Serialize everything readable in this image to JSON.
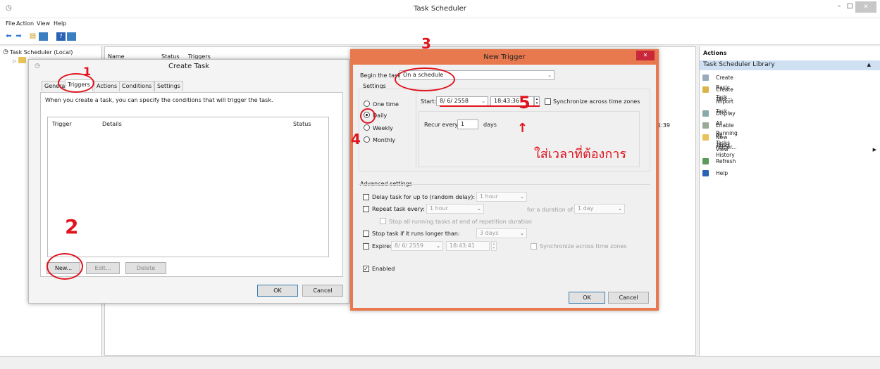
{
  "window": {
    "title": "Task Scheduler"
  },
  "menu": [
    "File",
    "Action",
    "View",
    "Help"
  ],
  "tree": {
    "root": "Task Scheduler (Local)"
  },
  "list": {
    "columns": [
      "Name",
      "Status",
      "Triggers"
    ],
    "partial_time": "1:39"
  },
  "actions": {
    "header": "Actions",
    "section": "Task Scheduler Library",
    "items": [
      "Create Basic Task...",
      "Create Task...",
      "Import Task...",
      "Display All Running Tasks",
      "Enable All Tasks History",
      "New Folder...",
      "View",
      "Refresh",
      "Help"
    ]
  },
  "create_task": {
    "title": "Create Task",
    "tabs": [
      "General",
      "Triggers",
      "Actions",
      "Conditions",
      "Settings"
    ],
    "description": "When you create a task, you can specify the conditions that will trigger the task.",
    "columns": [
      "Trigger",
      "Details",
      "Status"
    ],
    "buttons": {
      "new": "New...",
      "edit": "Edit...",
      "delete": "Delete",
      "ok": "OK",
      "cancel": "Cancel"
    }
  },
  "new_trigger": {
    "title": "New Trigger",
    "begin_label": "Begin the task:",
    "begin_value": "On a schedule",
    "settings_label": "Settings",
    "options": [
      "One time",
      "Daily",
      "Weekly",
      "Monthly"
    ],
    "selected_option": "Daily",
    "start_label": "Start:",
    "start_date": "8/ 6/ 2558",
    "start_time": "18:43:36",
    "sync_label": "Synchronize across time zones",
    "recur_label": "Recur every:",
    "recur_value": "1",
    "recur_unit": "days",
    "advanced_label": "Advanced settings",
    "delay_label": "Delay task for up to (random delay):",
    "delay_value": "1 hour",
    "repeat_label": "Repeat task every:",
    "repeat_value": "1 hour",
    "duration_label": "for a duration of:",
    "duration_value": "1 day",
    "stop_running_label": "Stop all running tasks at end of repetition duration",
    "stop_longer_label": "Stop task if it runs longer than:",
    "stop_longer_value": "3 days",
    "expire_label": "Expire:",
    "expire_date": "8/ 6/ 2559",
    "expire_time": "18:43:41",
    "expire_sync_label": "Synchronize across time zones",
    "enabled_label": "Enabled",
    "ok": "OK",
    "cancel": "Cancel"
  },
  "annotations": {
    "n1": "1",
    "n2": "2",
    "n3": "3",
    "n4": "4",
    "n5": "5",
    "thai_note": "ใส่เวลาที่ต้องการ",
    "color": "#e0141e"
  },
  "colors": {
    "accent": "#3c7fb1",
    "trigger_titlebar": "#e8784e",
    "actions_section": "#cfe0f3"
  }
}
